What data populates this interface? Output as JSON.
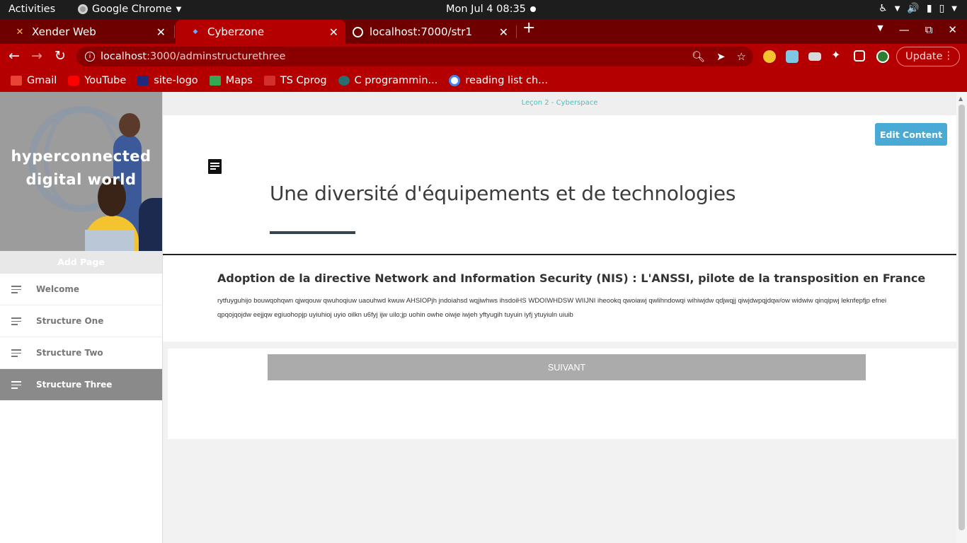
{
  "system_bar": {
    "activities": "Activities",
    "app_name": "Google Chrome",
    "clock": "Mon Jul 4  08:35"
  },
  "browser": {
    "tabs": [
      {
        "label": "Xender Web",
        "icon": "xender-icon",
        "active": false
      },
      {
        "label": "Cyberzone",
        "icon": "cyberzone-favicon",
        "active": true
      },
      {
        "label": "localhost:7000/str1",
        "icon": "globe-icon",
        "active": false
      }
    ],
    "url_host": "localhost",
    "url_path": ":3000/adminstructurethree",
    "update_label": "Update",
    "bookmarks": [
      {
        "label": "Gmail",
        "icon": "gmail-icon",
        "color": "#e94335"
      },
      {
        "label": "YouTube",
        "icon": "youtube-icon",
        "color": "#ff0000"
      },
      {
        "label": "site-logo",
        "icon": "site-logo-icon",
        "color": "#1f2a7a"
      },
      {
        "label": "Maps",
        "icon": "maps-icon",
        "color": "#34a853"
      },
      {
        "label": "TS Cprog",
        "icon": "ts-icon",
        "color": "#d32f2f"
      },
      {
        "label": "C programmin...",
        "icon": "c-prog-icon",
        "color": "#2a6f6f"
      },
      {
        "label": "reading list ch...",
        "icon": "google-icon",
        "color": "#4285f4"
      }
    ]
  },
  "sidebar": {
    "hero_title": "hyperconnected digital world",
    "add_page_label": "Add Page",
    "items": [
      {
        "label": "Welcome",
        "active": false
      },
      {
        "label": "Structure One",
        "active": false
      },
      {
        "label": "Structure Two",
        "active": false
      },
      {
        "label": "Structure Three",
        "active": true
      }
    ]
  },
  "main": {
    "lesson_label": "Leçon 2 - Cyberspace",
    "edit_button": "Edit Content",
    "heading": "Une diversité d'équipements et de technologies",
    "subheading": "Adoption de la directive Network and Information Security (NIS) : L'ANSSI, pilote de la transposition en France",
    "body": "rytfuyguhijo bouwqohqwn qjwqouw qwuhoqiuw uaouhwd kwuw AHSIOPjh jndoiahsd wqjiwhws ihsdoiHS WDOIWHDSW WIIJNI iheookq qwoiawj qwlihndowqi wihiwjdw qdjwqjj qiwjdwpqjdqw/ow widwiw qinqipwj leknfepfjp efnei qpqojqojdw eejjqw egiuohopjp uyiuhioj uyio oilkn u6fyj ijw uilo;jp uohin owhe oiwje iwjeh yftyugih tuyuin iyfj ytuyiuln uiuib",
    "next_button": "SUIVANT"
  },
  "colors": {
    "chrome_tab_active": "#b40000",
    "chrome_tabstrip": "#6f0000",
    "edit_button": "#4aaad6",
    "lesson_link": "#3cc7c7",
    "nav_active": "#8a8a8a",
    "next_button": "#ababab"
  }
}
